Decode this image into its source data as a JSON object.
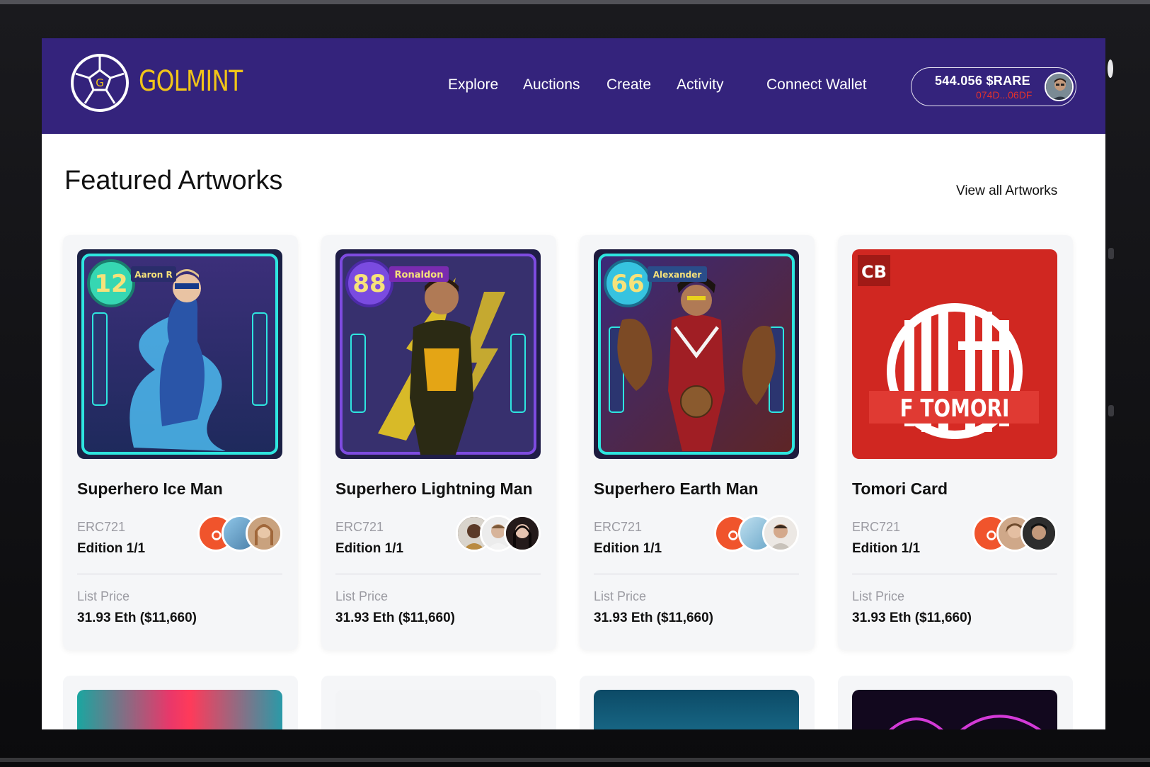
{
  "brand": {
    "name": "GOLMINT",
    "logo_letter": "G"
  },
  "nav": {
    "items": [
      {
        "label": "Explore"
      },
      {
        "label": "Auctions"
      },
      {
        "label": "Create"
      },
      {
        "label": "Activity"
      }
    ],
    "connect_wallet": "Connect Wallet"
  },
  "wallet": {
    "balance": "544.056 $RARE",
    "address": "074D...06DF"
  },
  "featured": {
    "title": "Featured Artworks",
    "view_all": "View all Artworks",
    "cards": [
      {
        "title": "Superhero Ice Man",
        "standard": "ERC721",
        "edition": "Edition 1/1",
        "price_label": "List Price",
        "price": "31.93 Eth ($11,660)",
        "card_rating": "12",
        "card_name": "Aaron R"
      },
      {
        "title": "Superhero Lightning Man",
        "standard": "ERC721",
        "edition": "Edition 1/1",
        "price_label": "List Price",
        "price": "31.93 Eth ($11,660)",
        "card_rating": "88",
        "card_name": "Ronaldon"
      },
      {
        "title": "Superhero Earth Man",
        "standard": "ERC721",
        "edition": "Edition 1/1",
        "price_label": "List Price",
        "price": "31.93 Eth ($11,660)",
        "card_rating": "66",
        "card_name": "Alexander"
      },
      {
        "title": "Tomori Card",
        "standard": "ERC721",
        "edition": "Edition 1/1",
        "price_label": "List Price",
        "price": "31.93 Eth ($11,660)",
        "card_position": "CB",
        "card_name": "F TOMORI"
      }
    ]
  },
  "colors": {
    "header_bg": "#34237c",
    "brand_gold": "#f0c419",
    "address_red": "#e0322e",
    "card_bg": "#f5f6f8"
  }
}
